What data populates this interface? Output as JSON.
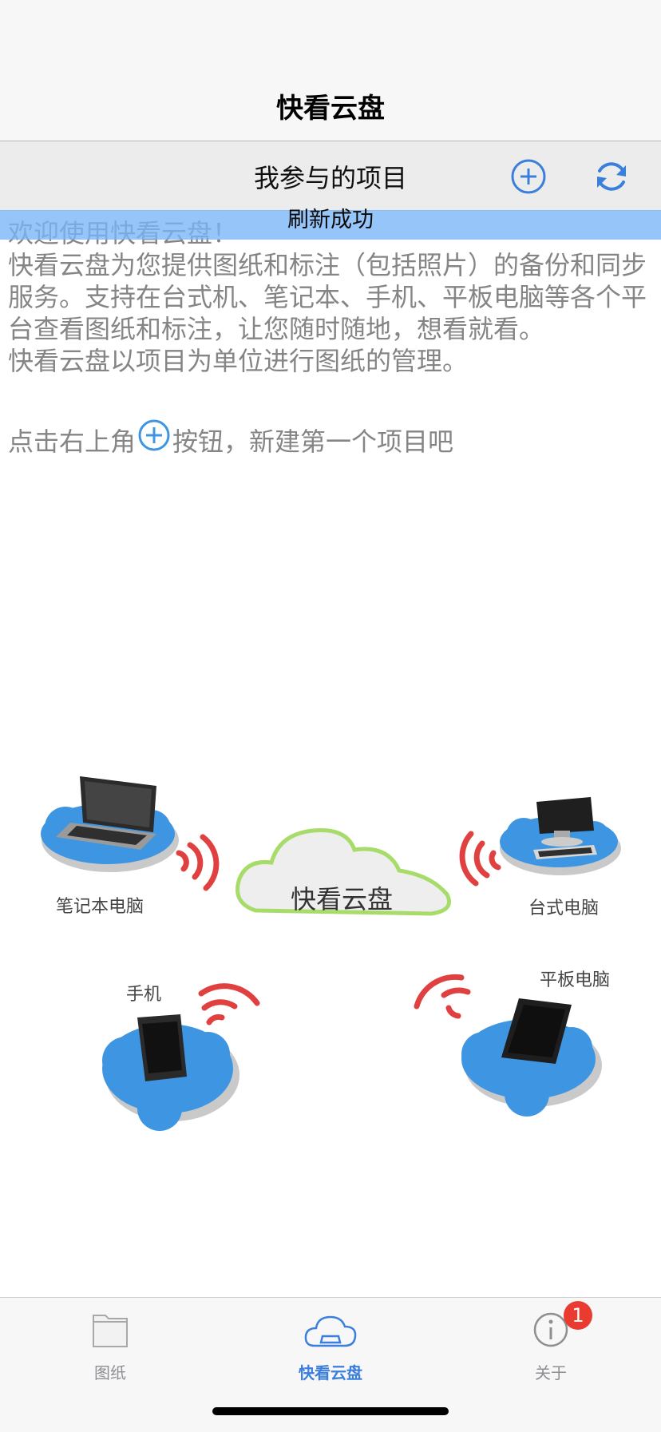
{
  "app": {
    "title": "快看云盘"
  },
  "subbar": {
    "title": "我参与的项目",
    "add_icon": "plus-circle-icon",
    "refresh_icon": "refresh-icon"
  },
  "toast": {
    "text": "刷新成功"
  },
  "content": {
    "welcome": "欢迎使用快看云盘！",
    "paragraph1": "快看云盘为您提供图纸和标注（包括照片）的备份和同步服务。支持在台式机、笔记本、手机、平板电脑等各个平台查看图纸和标注，让您随时随地，想看就看。",
    "paragraph2": "快看云盘以项目为单位进行图纸的管理。",
    "hint_before": "点击右上角",
    "hint_after": "按钮，新建第一个项目吧"
  },
  "illustration": {
    "center_label": "快看云盘",
    "laptop_label": "笔记本电脑",
    "desktop_label": "台式电脑",
    "phone_label": "手机",
    "tablet_label": "平板电脑"
  },
  "tabs": [
    {
      "label": "图纸",
      "icon": "folder-icon",
      "active": false
    },
    {
      "label": "快看云盘",
      "icon": "cloud-drive-icon",
      "active": true
    },
    {
      "label": "关于",
      "icon": "info-icon",
      "active": false,
      "badge": "1"
    }
  ],
  "colors": {
    "accent": "#3b7fdc",
    "badge": "#ea3b30",
    "toast": "#78b6f7",
    "cloud_blue": "#3e96e2",
    "cloud_green": "#a7dc6a",
    "signal_red": "#e04040"
  }
}
